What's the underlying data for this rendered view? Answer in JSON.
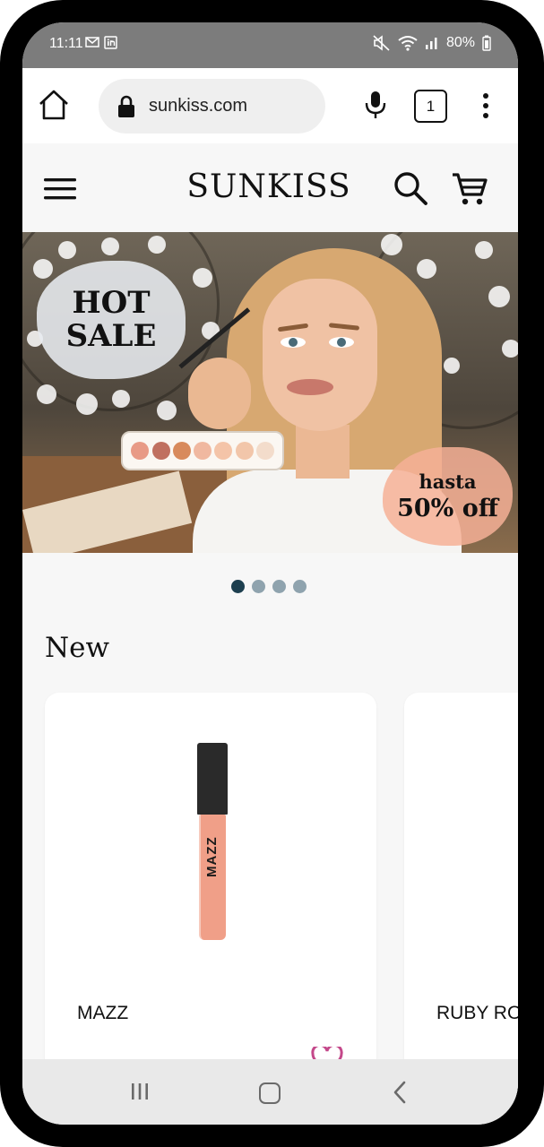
{
  "status_bar": {
    "time": "11:11",
    "battery": "80%",
    "icons": [
      "mail-icon",
      "linkedin-icon",
      "mute-icon",
      "wifi-icon",
      "signal-icon",
      "battery-icon"
    ]
  },
  "browser": {
    "url": "sunkiss.com",
    "tab_count": "1",
    "icons": [
      "home-icon",
      "lock-icon",
      "mic-icon",
      "tabs-icon",
      "more-vert-icon"
    ]
  },
  "site": {
    "brand": "SUNKISS",
    "icons": [
      "menu-icon",
      "search-icon",
      "cart-icon"
    ]
  },
  "hero": {
    "badge_line1": "HOT",
    "badge_line2": "SALE",
    "promo_line1": "hasta",
    "promo_line2": "50% off",
    "slides_count": 4,
    "active_slide": 1,
    "palette_colors": [
      "#e89a86",
      "#c07060",
      "#d88a5c",
      "#f0b8a0",
      "#f4c4a8",
      "#f2c6aa",
      "#f3dccb"
    ]
  },
  "section": {
    "title": "New",
    "products": [
      {
        "name": "MAZZ",
        "package_label": "MAZZ"
      },
      {
        "name": "RUBY RO"
      }
    ]
  },
  "colors": {
    "active_dot": "#1d3f4f",
    "inactive_dot": "#8fa3ae",
    "heart": "#c4488a",
    "product_tube": "#f09f88"
  }
}
